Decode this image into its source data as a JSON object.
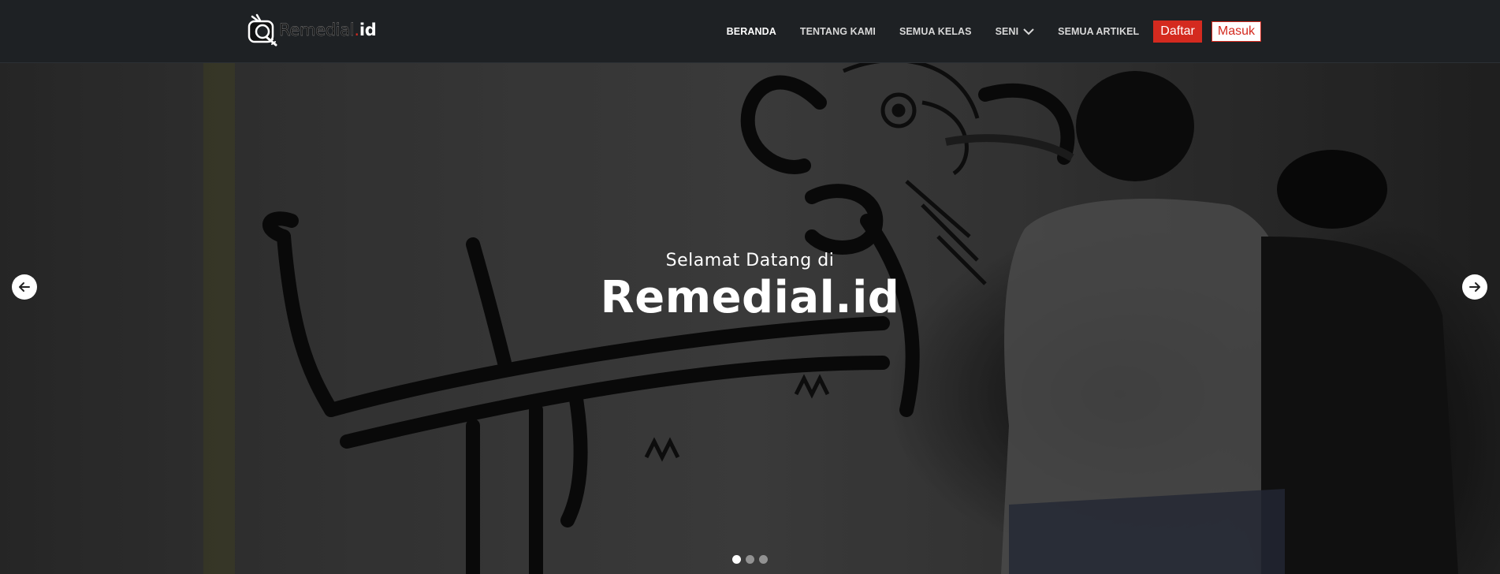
{
  "brand": {
    "logo_text_main": "Remedial",
    "logo_text_dot": ".",
    "logo_text_suffix": "id",
    "accent_color": "#d42a1f"
  },
  "nav": {
    "items": [
      {
        "label": "BERANDA",
        "active": true
      },
      {
        "label": "TENTANG KAMI",
        "active": false
      },
      {
        "label": "SEMUA KELAS",
        "active": false
      },
      {
        "label": "SENI",
        "active": false,
        "has_dropdown": true,
        "icon": "chevron-down-icon"
      },
      {
        "label": "SEMUA ARTIKEL",
        "active": false
      }
    ],
    "register_label": "Daftar",
    "login_label": "Masuk"
  },
  "hero": {
    "subtitle": "Selamat Datang di",
    "title": "Remedial.id",
    "prev_icon": "arrow-left-icon",
    "next_icon": "arrow-right-icon",
    "slide_count": 3,
    "active_slide": 1
  }
}
